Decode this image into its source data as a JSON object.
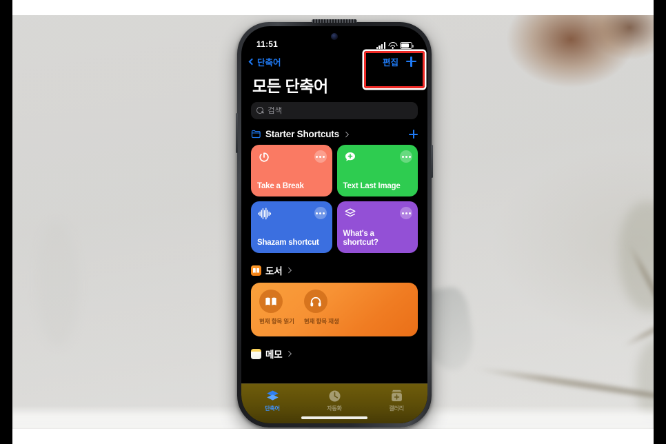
{
  "background": {
    "description": "blurred light-gray wall with out-of-focus plant stems on the right"
  },
  "status_bar": {
    "time": "11:51",
    "icons": [
      "cellular-signal-icon",
      "wifi-icon",
      "battery-icon"
    ]
  },
  "nav": {
    "back_label": "단축어",
    "edit_label": "편집",
    "add_icon": "plus-icon"
  },
  "annotation": {
    "highlight_color": "#ef2b27",
    "target": "편집 +"
  },
  "page_title": "모든 단축어",
  "search": {
    "value": "",
    "placeholder": "검색",
    "icon": "search-icon"
  },
  "sections": [
    {
      "title": "Starter Shortcuts",
      "icon": "folder-icon",
      "icon_color": "#1f7bf6",
      "has_add": true,
      "type": "grid",
      "cards": [
        {
          "label": "Take a Break",
          "color": "#fa7a63",
          "icon": "timer-icon",
          "menu": "more-options-icon"
        },
        {
          "label": "Text Last Image",
          "color": "#2ecc50",
          "icon": "message-plus-icon",
          "menu": "more-options-icon"
        },
        {
          "label": "Shazam shortcut",
          "color": "#3b6fe0",
          "icon": "waveform-icon",
          "menu": "more-options-icon"
        },
        {
          "label": "What's a\nshortcut?",
          "color": "#9350d6",
          "icon": "layers-icon",
          "menu": "more-options-icon"
        }
      ]
    },
    {
      "title": "도서",
      "icon": "books-app-icon",
      "icon_color": "#f5871f",
      "has_add": false,
      "type": "wide",
      "actions": [
        {
          "label": "현재 항목 읽기",
          "icon": "open-book-icon"
        },
        {
          "label": "현재 항목 재생",
          "icon": "headphones-icon"
        }
      ]
    },
    {
      "title": "메모",
      "icon": "notes-app-icon",
      "icon_color": "#fbd45c",
      "has_add": false,
      "type": "header-only"
    }
  ],
  "tabbar": {
    "tabs": [
      {
        "label": "단축어",
        "icon": "shortcuts-layers-icon",
        "active": true
      },
      {
        "label": "자동화",
        "icon": "automation-clock-icon",
        "active": false
      },
      {
        "label": "갤러리",
        "icon": "gallery-icon",
        "active": false
      }
    ]
  },
  "cards": {
    "c0": "Take a Break",
    "c1": "Text Last Image",
    "c2": "Shazam shortcut",
    "c3_line1": "What's a",
    "c3_line2": "shortcut?"
  }
}
